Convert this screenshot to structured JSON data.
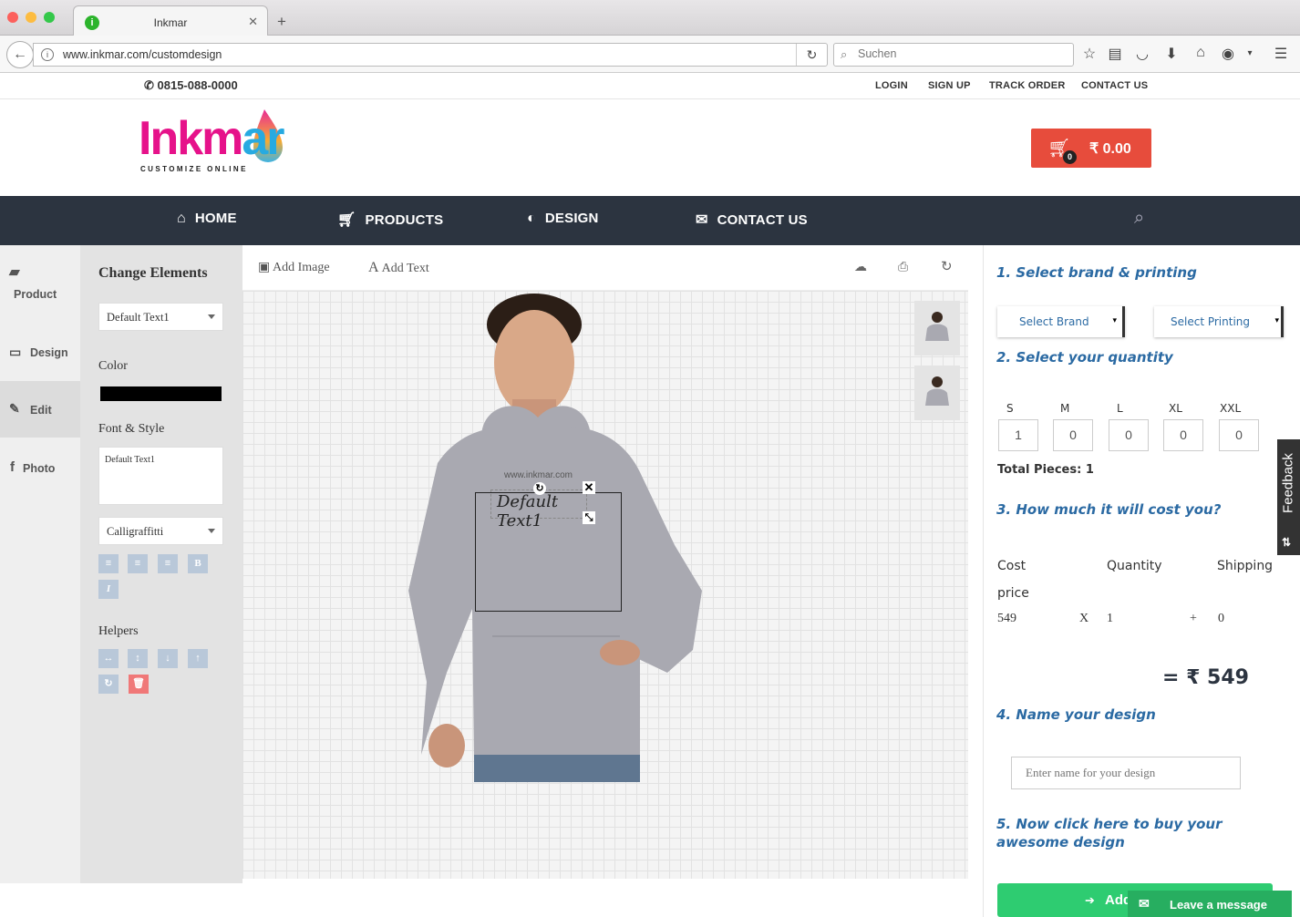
{
  "browser": {
    "tab_title": "Inkmar",
    "url": "www.inkmar.com/customdesign",
    "search_placeholder": "Suchen"
  },
  "topbar": {
    "phone": "0815-088-0000",
    "links": [
      "LOGIN",
      "SIGN UP",
      "TRACK ORDER",
      "CONTACT US"
    ]
  },
  "header": {
    "logo_text": "Inkmar",
    "logo_tagline": "CUSTOMIZE ONLINE",
    "cart_count": "0",
    "cart_total": "₹ 0.00"
  },
  "nav": [
    "HOME",
    "PRODUCTS",
    "DESIGN",
    "CONTACT US"
  ],
  "left_tabs": [
    "Product",
    "Design",
    "Edit",
    "Photo"
  ],
  "panel": {
    "heading": "Change Elements",
    "element_select": "Default Text1",
    "color_label": "Color",
    "color_value": "#000000",
    "font_label": "Font & Style",
    "text_value": "Default Text1",
    "font_select": "Calligraffitti",
    "helpers_label": "Helpers"
  },
  "canvas": {
    "add_image": "Add Image",
    "add_text": "Add Text",
    "watermark": "www.inkmar.com",
    "text_element": "Default Text1"
  },
  "right": {
    "step1": "1. Select brand & printing",
    "brand_select": "Select Brand",
    "printing_select": "Select Printing",
    "step2": "2. Select your quantity",
    "sizes": [
      {
        "size": "S",
        "qty": "1"
      },
      {
        "size": "M",
        "qty": "0"
      },
      {
        "size": "L",
        "qty": "0"
      },
      {
        "size": "XL",
        "qty": "0"
      },
      {
        "size": "XXL",
        "qty": "0"
      }
    ],
    "total_pieces": "Total Pieces: 1",
    "step3": "3. How much it will cost you?",
    "cost_label_1": "Cost",
    "cost_label_2": "price",
    "quantity_label": "Quantity",
    "shipping_label": "Shipping",
    "cost_value": "549",
    "times": "X",
    "qty_value": "1",
    "plus": "+",
    "shipping_value": "0",
    "total": "= ₹ 549",
    "step4": "4. Name your design",
    "name_placeholder": "Enter name for your design",
    "step5": "5. Now click here to buy your awesome design",
    "add_button": "Add"
  },
  "widgets": {
    "feedback": "Feedback",
    "leave_message": "Leave a message"
  },
  "colors": {
    "nav_bg": "#2c3440",
    "cart_bg": "#e74c3c",
    "accent_blue": "#2b6aa3",
    "green": "#2ecc71"
  }
}
